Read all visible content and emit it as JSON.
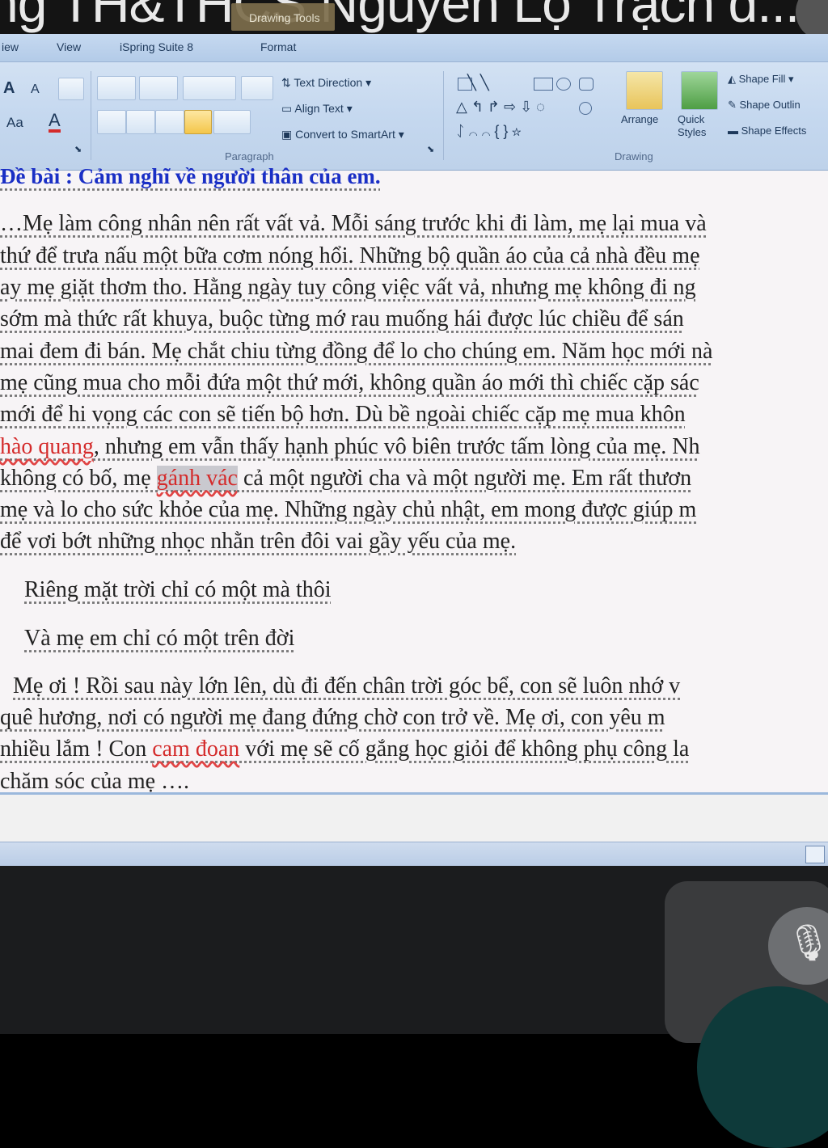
{
  "window": {
    "title": "ng TH&THCS Nguyễn Lộ Trạch d...",
    "context_tab": "Drawing Tools"
  },
  "ribbon": {
    "tabs": [
      "iew",
      "View",
      "iSpring Suite 8",
      "Format"
    ],
    "paragraph": {
      "text_direction": "Text Direction",
      "align_text": "Align Text",
      "convert_smartart": "Convert to SmartArt",
      "label": "Paragraph"
    },
    "drawing": {
      "arrange": "Arrange",
      "quick_styles": "Quick Styles",
      "shape_fill": "Shape Fill",
      "shape_outline": "Shape Outlin",
      "shape_effects": "Shape Effects",
      "label": "Drawing"
    },
    "font": {
      "grow": "A",
      "shrink": "A",
      "case": "Aa",
      "color": "A"
    }
  },
  "document": {
    "heading": "Đề bài : Cảm nghĩ về người thân của em.",
    "lines": [
      "…Mẹ làm công nhân nên rất vất vả. Mỗi sáng trước khi đi làm, mẹ lại mua và",
      "thứ để trưa nấu một bữa cơm nóng hổi. Những bộ quần áo của cả nhà đều mẹ",
      "ay mẹ giặt thơm tho. Hằng ngày tuy công việc vất vả, nhưng mẹ không đi ng",
      "sớm mà thức rất khuya, buộc từng mớ rau muống hái được lúc chiều để sán",
      "mai đem đi bán. Mẹ chắt chiu từng đồng để lo cho chúng em. Năm học mới nà",
      "mẹ cũng mua cho mỗi đứa một thứ mới, không quần áo mới thì chiếc cặp sác",
      "mới để hi vọng các con sẽ tiến bộ hơn. Dù bề ngoài chiếc cặp mẹ mua khôn"
    ],
    "line8": {
      "red": "hào quang",
      "rest": ", nhưng em vẫn thấy hạnh phúc vô biên trước tấm lòng của mẹ. Nh"
    },
    "line9": {
      "pre": "không có bố, mẹ ",
      "sel": "gánh vác",
      "rest": " cả một người cha và một người mẹ. Em rất thươn"
    },
    "line10": "mẹ và lo cho sức khỏe của mẹ. Những ngày chủ nhật, em mong được giúp m",
    "line11": "để vơi bớt những nhọc nhằn trên đôi vai gầy yếu của mẹ.",
    "poem1": "Riêng mặt trời chỉ có một mà thôi",
    "poem2": "Và mẹ em chỉ có một trên đời",
    "closing1": "Mẹ ơi ! Rồi sau này lớn lên, dù đi đến chân trời góc bể, con sẽ luôn nhớ v",
    "closing2": "quê hương, nơi có người mẹ đang đứng chờ con trở về. Mẹ ơi, con yêu m",
    "closing3": {
      "pre": "nhiều lắm ! Con ",
      "red": "cam đoan",
      "rest": " với mẹ sẽ cố gắng học giỏi để không phụ công la"
    },
    "closing4": "chăm sóc của mẹ …."
  },
  "colors": {
    "heading": "#1a2fc5",
    "spelling": "#d42b2b",
    "ribbon": "#c5d8ef"
  }
}
